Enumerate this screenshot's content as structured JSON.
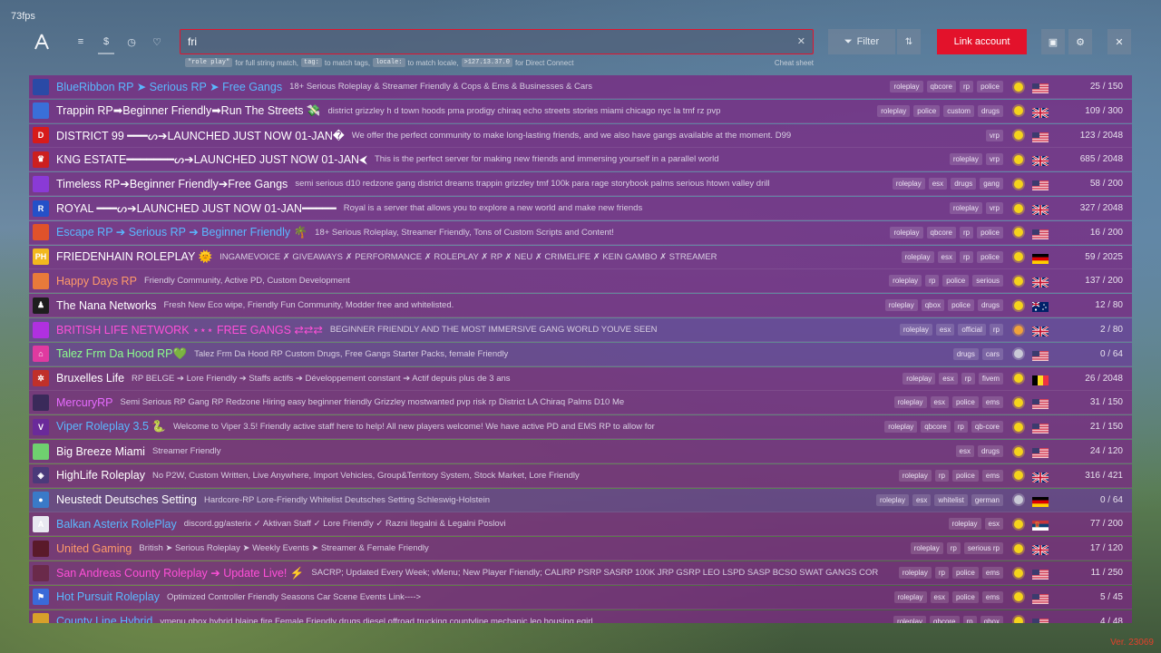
{
  "fps": "73fps",
  "nav": {
    "items": [
      "list-icon",
      "dollar-icon",
      "clock-icon",
      "heart-icon"
    ]
  },
  "search": {
    "value": "fri",
    "placeholder": ""
  },
  "hints": {
    "code1": "\"role play\"",
    "text1": "for full string match,",
    "code2": "tag:",
    "text2": "to match tags,",
    "code3": "locale:",
    "text3": "to match locale,",
    "code4": ">127.13.37.0",
    "text4": "for Direct Connect",
    "cheat": "Cheat sheet"
  },
  "toolbar": {
    "filter_label": "Filter",
    "link_label": "Link account"
  },
  "colors": {
    "accent": "#e3122b",
    "row": "#782882",
    "status_on": "#f5d31b",
    "status_off": "#c9c9d6",
    "status_dot": "#f0a23a"
  },
  "servers": [
    {
      "name": "BlueRibbon RP ➤ Serious RP ➤ Free Gangs",
      "name_color": "#5ab8ff",
      "desc": "18+ Serious Roleplay & Streamer Friendly & Cops & Ems & Businesses & Cars",
      "tags": [
        "roleplay",
        "qbcore",
        "rp",
        "police"
      ],
      "flag": "us",
      "status": "on",
      "players": "25 / 150",
      "icon_bg": "#2a4aa6",
      "icon_text": ""
    },
    {
      "name": "Trappin RP➡Beginner Friendly➡Run The Streets 💸",
      "name_color": "#ffffff",
      "desc": "district grizzley h d town hoods pma prodigy chiraq echo streets stories miami chicago nyc la tmf rz pvp",
      "tags": [
        "roleplay",
        "police",
        "custom",
        "drugs"
      ],
      "flag": "gb",
      "status": "on",
      "players": "109 / 300",
      "icon_bg": "#3a6fd8",
      "icon_text": ""
    },
    {
      "name": "DISTRICT 99 ━━━ᔕ➔LAUNCHED JUST NOW 01-JAN�",
      "name_color": "#ffffff",
      "desc": "We offer the perfect community to make long-lasting friends, and we also have gangs available at the moment. D99",
      "tags": [
        "vrp"
      ],
      "flag": "us",
      "status": "on",
      "players": "123 / 2048",
      "icon_bg": "#d71b1b",
      "icon_text": "D"
    },
    {
      "name": "KNG ESTATE━━━━━━━ᔕ➔LAUNCHED JUST NOW 01-JAN⮜",
      "name_color": "#ffffff",
      "desc": "This is the perfect server for making new friends and immersing yourself in a parallel world",
      "tags": [
        "roleplay",
        "vrp"
      ],
      "flag": "gb",
      "status": "on",
      "players": "685 / 2048",
      "icon_bg": "#cc1f1f",
      "icon_text": "♛"
    },
    {
      "name": "Timeless RP➔Beginner Friendly➔Free Gangs",
      "name_color": "#ffffff",
      "desc": "semi serious d10 redzone gang district dreams trappin grizzley tmf 100k para rage storybook palms serious htown valley drill",
      "tags": [
        "roleplay",
        "esx",
        "drugs",
        "gang"
      ],
      "flag": "us",
      "status": "on",
      "players": "58 / 200",
      "icon_bg": "#8a3ad6",
      "icon_text": ""
    },
    {
      "name": "ROYAL ━━━ᔕ➔LAUNCHED JUST NOW 01-JAN━━━━━",
      "name_color": "#ffffff",
      "desc": "Royal is a server that allows you to explore a new world and make new friends",
      "tags": [
        "roleplay",
        "vrp"
      ],
      "flag": "gb",
      "status": "on",
      "players": "327 / 2048",
      "icon_bg": "#2450c8",
      "icon_text": "R"
    },
    {
      "name": "Escape RP ➔ Serious RP ➔ Beginner Friendly 🌴",
      "name_color": "#5ab8ff",
      "desc": "18+ Serious Roleplay, Streamer Friendly, Tons of Custom Scripts and Content!",
      "tags": [
        "roleplay",
        "qbcore",
        "rp",
        "police"
      ],
      "flag": "us",
      "status": "on",
      "players": "16 / 200",
      "icon_bg": "#e0522a",
      "icon_text": ""
    },
    {
      "name": "FRIEDENHAIN ROLEPLAY 🌞",
      "name_color": "#ffffff",
      "desc": "INGAMEVOICE ✗ GIVEAWAYS ✗ PERFORMANCE ✗ ROLEPLAY ✗ RP ✗ NEU ✗ CRIMELIFE ✗ KEIN GAMBO ✗ STREAMER",
      "tags": [
        "roleplay",
        "esx",
        "rp",
        "police"
      ],
      "flag": "de",
      "status": "on",
      "players": "59 / 2025",
      "icon_bg": "#f2b81e",
      "icon_text": "PH"
    },
    {
      "name": "Happy Days RP",
      "name_color": "#ff9a6a",
      "desc": "Friendly Community, Active PD, Custom Development",
      "tags": [
        "roleplay",
        "rp",
        "police",
        "serious"
      ],
      "flag": "gb",
      "status": "on",
      "players": "137 / 200",
      "icon_bg": "#e87a3a",
      "icon_text": ""
    },
    {
      "name": "The Nana Networks",
      "name_color": "#ffffff",
      "desc": "Fresh New Eco wipe, Friendly Fun Community, Modder free and whitelisted.",
      "tags": [
        "roleplay",
        "qbox",
        "police",
        "drugs"
      ],
      "flag": "au",
      "status": "on",
      "players": "12 / 80",
      "icon_bg": "#1e1e1e",
      "icon_text": "♟"
    },
    {
      "name": "BRITISH LIFE NETWORK ⋆⋆⋆ FREE GANGS ⇄⇄⇄",
      "name_color": "#ff4fd8",
      "desc": "BEGINNER FRIENDLY AND THE MOST IMMERSIVE GANG WORLD YOUVE SEEN",
      "tags": [
        "roleplay",
        "esx",
        "official",
        "rp"
      ],
      "flag": "gb",
      "status": "dot",
      "players": "2 / 80",
      "icon_bg": "#b030e0",
      "icon_text": ""
    },
    {
      "name": "Talez Frm Da Hood RP💚",
      "name_color": "#8cff8c",
      "desc": "Talez Frm Da Hood RP Custom Drugs, Free Gangs Starter Packs, female Friendly",
      "tags": [
        "drugs",
        "cars"
      ],
      "flag": "us",
      "status": "off",
      "players": "0 / 64",
      "icon_bg": "#e03aa0",
      "icon_text": "⌂"
    },
    {
      "name": "Bruxelles Life",
      "name_color": "#ffffff",
      "desc": "RP BELGE ➔ Lore Friendly ➔ Staffs actifs ➔ Développement constant ➔ Actif depuis plus de 3 ans",
      "tags": [
        "roleplay",
        "esx",
        "rp",
        "fivem"
      ],
      "flag": "be",
      "status": "on",
      "players": "26 / 2048",
      "icon_bg": "#c0302a",
      "icon_text": "✲"
    },
    {
      "name": "MercuryRP",
      "name_color": "#e66bff",
      "desc": "Semi Serious RP Gang RP Redzone Hiring easy beginner friendly Grizzley mostwanted pvp risk rp District LA Chiraq Palms D10 Me",
      "tags": [
        "roleplay",
        "esx",
        "police",
        "ems"
      ],
      "flag": "us",
      "status": "on",
      "players": "31 / 150",
      "icon_bg": "#3a2a5a",
      "icon_text": ""
    },
    {
      "name": "Viper Roleplay 3.5 🐍",
      "name_color": "#5ab8ff",
      "desc": "Welcome to Viper 3.5! Friendly active staff here to help! All new players welcome! We have active PD and EMS RP to allow for",
      "tags": [
        "roleplay",
        "qbcore",
        "rp",
        "qb-core"
      ],
      "flag": "us",
      "status": "on",
      "players": "21 / 150",
      "icon_bg": "#6a2a9a",
      "icon_text": "V"
    },
    {
      "name": "Big Breeze Miami",
      "name_color": "#ffffff",
      "desc": "Streamer Friendly",
      "tags": [
        "esx",
        "drugs"
      ],
      "flag": "us",
      "status": "on",
      "players": "24 / 120",
      "icon_bg": "#6fd06f",
      "icon_text": ""
    },
    {
      "name": "HighLife Roleplay",
      "name_color": "#ffffff",
      "desc": "No P2W, Custom Written, Live Anywhere, Import Vehicles, Group&Territory System, Stock Market, Lore Friendly",
      "tags": [
        "roleplay",
        "rp",
        "police",
        "ems"
      ],
      "flag": "gb",
      "status": "on",
      "players": "316 / 421",
      "icon_bg": "#4a3a7a",
      "icon_text": "◈"
    },
    {
      "name": "Neustedt Deutsches Setting",
      "name_color": "#ffffff",
      "desc": "Hardcore-RP Lore-Friendly Whitelist Deutsches Setting Schleswig-Holstein",
      "tags": [
        "roleplay",
        "esx",
        "whitelist",
        "german"
      ],
      "flag": "de",
      "status": "off",
      "players": "0 / 64",
      "icon_bg": "#3a7ac8",
      "icon_text": "●"
    },
    {
      "name": "Balkan Asterix RolePlay",
      "name_color": "#5ab8ff",
      "desc": "discord.gg/asterix ✓ Aktivan Staff ✓ Lore Friendly ✓ Razni Ilegalni & Legalni Poslovi",
      "tags": [
        "roleplay",
        "esx"
      ],
      "flag": "rs",
      "status": "on",
      "players": "77 / 200",
      "icon_bg": "#e8e8f0",
      "icon_text": "A"
    },
    {
      "name": "United Gaming",
      "name_color": "#ff9a6a",
      "desc": "British ➤ Serious Roleplay ➤ Weekly Events ➤ Streamer & Female Friendly",
      "tags": [
        "roleplay",
        "rp",
        "serious rp"
      ],
      "flag": "gb",
      "status": "on",
      "players": "17 / 120",
      "icon_bg": "#5a1a2a",
      "icon_text": ""
    },
    {
      "name": "San Andreas County Roleplay ➔ Update Live! ⚡",
      "name_color": "#ff4fd8",
      "desc": "SACRP; Updated Every Week; vMenu; New Player Friendly; CALIRP PSRP SASRP 100K JRP GSRP LEO LSPD SASP BCSO SWAT GANGS COR",
      "tags": [
        "roleplay",
        "rp",
        "police",
        "ems"
      ],
      "flag": "us",
      "status": "on",
      "players": "11 / 250",
      "icon_bg": "#6a2a4a",
      "icon_text": ""
    },
    {
      "name": "Hot Pursuit Roleplay",
      "name_color": "#5ab8ff",
      "desc": "Optimized Controller Friendly Seasons Car Scene Events Link---->",
      "tags": [
        "roleplay",
        "esx",
        "police",
        "ems"
      ],
      "flag": "us",
      "status": "on",
      "players": "5 / 45",
      "icon_bg": "#3a6ad8",
      "icon_text": "⚑"
    },
    {
      "name": "County Line Hybrid",
      "name_color": "#5ab8ff",
      "desc": "vmenu qbox hybrid blaine fire Female Friendly drugs diesel offroad trucking countyline mechanic leo housing egirl",
      "tags": [
        "roleplay",
        "qbcore",
        "rp",
        "qbox"
      ],
      "flag": "us",
      "status": "on",
      "players": "4 / 48",
      "icon_bg": "#d8a02a",
      "icon_text": ""
    }
  ],
  "version": "Ver. 23069"
}
